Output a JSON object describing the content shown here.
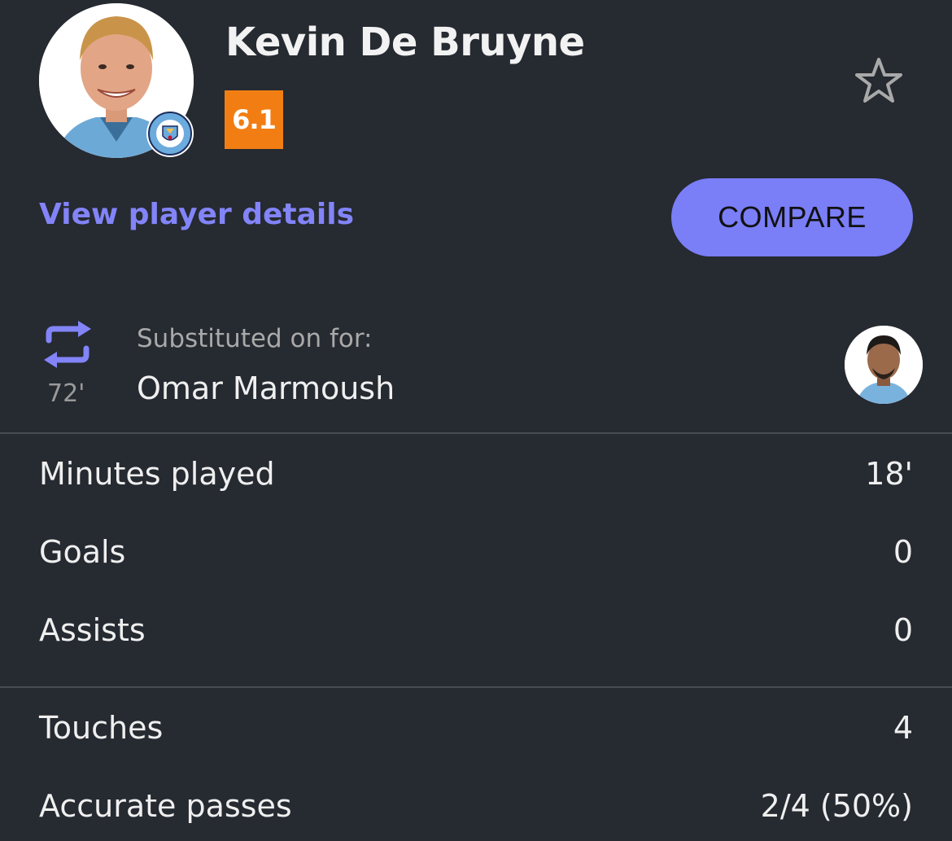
{
  "player": {
    "name": "Kevin De Bruyne",
    "rating": "6.1",
    "rating_color": "#f27e13"
  },
  "actions": {
    "view_details": "View player details",
    "compare": "COMPARE",
    "favorite_icon": "star-outline-icon"
  },
  "substitution": {
    "icon": "swap-arrows-icon",
    "minute": "72'",
    "label": "Substituted on for:",
    "player_name": "Omar Marmoush"
  },
  "stats_group_1": [
    {
      "label": "Minutes played",
      "value": "18'"
    },
    {
      "label": "Goals",
      "value": "0"
    },
    {
      "label": "Assists",
      "value": "0"
    }
  ],
  "stats_group_2": [
    {
      "label": "Touches",
      "value": "4"
    },
    {
      "label": "Accurate passes",
      "value": "2/4 (50%)"
    }
  ],
  "colors": {
    "background": "#262a31",
    "accent": "#7a7ef7",
    "link": "#8284f8"
  }
}
